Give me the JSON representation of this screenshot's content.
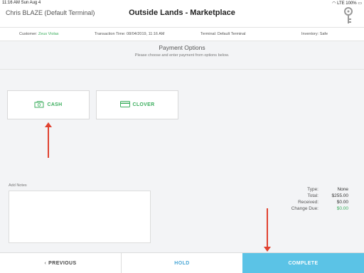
{
  "statusbar": {
    "time_date": "11:16 AM   Sun Aug 4",
    "signal": "LTE",
    "battery": "100%"
  },
  "header": {
    "user": "Chris BLAZE (Default Terminal)",
    "title": "Outside Lands - Marketplace",
    "key_icon": "key-icon"
  },
  "info": {
    "customer_label": "Customer:",
    "customer_value": "Zeus Violas",
    "transaction_label": "Transaction Time:",
    "transaction_value": "08/04/2019, 11:16 AM",
    "terminal_label": "Terminal:",
    "terminal_value": "Default Terminal",
    "inventory_label": "Inventory:",
    "inventory_value": "Safe"
  },
  "payment": {
    "title": "Payment Options",
    "subtitle": "Please choose and enter payment from options below.",
    "options": [
      {
        "label": "CASH",
        "icon": "cash-icon"
      },
      {
        "label": "CLOVER",
        "icon": "card-icon"
      }
    ]
  },
  "notes": {
    "label": "Add Notes",
    "value": ""
  },
  "summary": {
    "type_label": "Type:",
    "type_value": "None",
    "total_label": "Total:",
    "total_value": "$255.00",
    "received_label": "Received:",
    "received_value": "$0.00",
    "change_label": "Change Due:",
    "change_value": "$0.00"
  },
  "footer": {
    "prev_label": "PREVIOUS",
    "hold_label": "HOLD",
    "complete_label": "COMPLETE"
  },
  "colors": {
    "accent_green": "#3cae5e",
    "complete_blue": "#5bc3e6",
    "annotation_red": "#e0412f"
  }
}
